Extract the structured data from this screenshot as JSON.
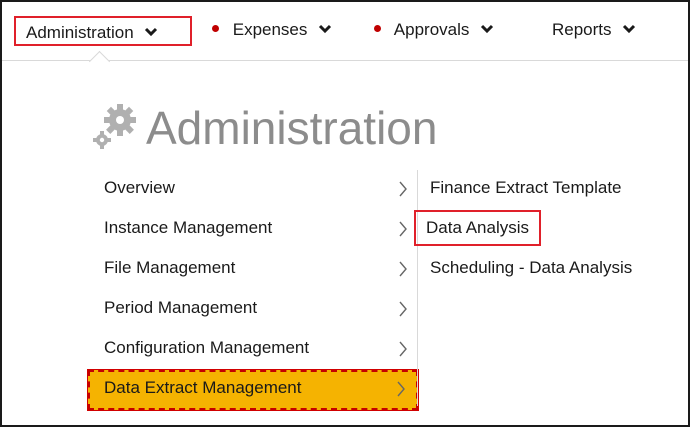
{
  "nav": {
    "items": [
      {
        "label": "Administration",
        "icon": "chevron-down-icon",
        "highlighted": true
      },
      {
        "label": "Expenses",
        "icon": "chevron-down-icon",
        "dot": true
      },
      {
        "label": "Approvals",
        "icon": "chevron-down-icon",
        "dot": true
      },
      {
        "label": "Reports",
        "icon": "chevron-down-icon"
      }
    ],
    "dot_color": "#c00000"
  },
  "panel": {
    "title": "Administration",
    "title_icon": "gears-icon"
  },
  "menu": {
    "items": [
      {
        "label": "Overview"
      },
      {
        "label": "Instance Management"
      },
      {
        "label": "File Management"
      },
      {
        "label": "Period Management"
      },
      {
        "label": "Configuration Management"
      },
      {
        "label": "Data Extract Management",
        "active": true
      }
    ],
    "active_color": "#f5b301"
  },
  "submenu": {
    "items": [
      {
        "label": "Finance Extract Template"
      },
      {
        "label": "Data Analysis",
        "highlighted": true
      },
      {
        "label": "Scheduling - Data Analysis"
      }
    ]
  },
  "colors": {
    "highlight_border": "#e0202a",
    "title_gray": "#8c8c8c"
  }
}
